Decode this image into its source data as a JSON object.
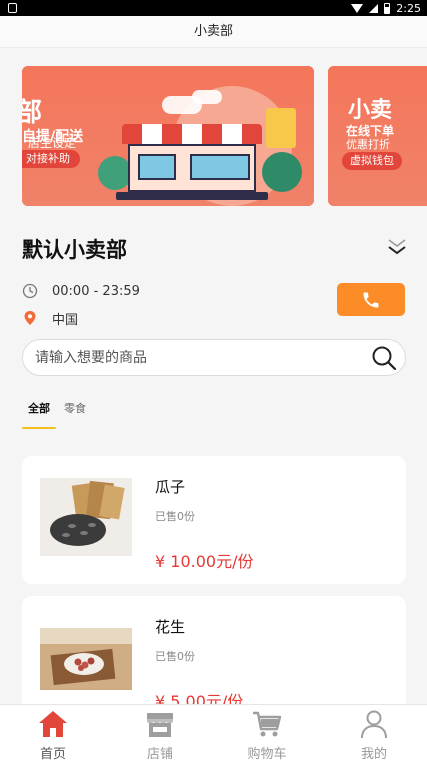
{
  "status_bar": {
    "time": "2:25"
  },
  "header": {
    "title": "小卖部"
  },
  "banners": [
    {
      "title": "部",
      "line1": "自提/配送",
      "line2": "店主设定",
      "tag": "对接补助"
    },
    {
      "title": "小卖",
      "line1": "在线下单",
      "line2": "优惠打折",
      "tag": "虚拟钱包"
    }
  ],
  "shop": {
    "name": "默认小卖部",
    "hours": "00:00 - 23:59",
    "location": "中国"
  },
  "search": {
    "placeholder": "请输入想要的商品"
  },
  "category_tabs": [
    {
      "label": "全部",
      "active": true
    },
    {
      "label": "零食",
      "active": false
    }
  ],
  "products": [
    {
      "name": "瓜子",
      "sold": "已售0份",
      "price": "¥ 10.00元/份"
    },
    {
      "name": "花生",
      "sold": "已售0份",
      "price": "¥ 5.00元/份"
    }
  ],
  "tabbar": [
    {
      "label": "首页",
      "icon": "home-icon",
      "active": true
    },
    {
      "label": "店铺",
      "icon": "store-icon",
      "active": false
    },
    {
      "label": "购物车",
      "icon": "cart-icon",
      "active": false
    },
    {
      "label": "我的",
      "icon": "user-icon",
      "active": false
    }
  ],
  "colors": {
    "accent": "#fb8c28",
    "price": "#e53935",
    "tab_underline": "#f2c01c",
    "home_active": "#e2463a",
    "banner_bg": "#f4765a"
  }
}
